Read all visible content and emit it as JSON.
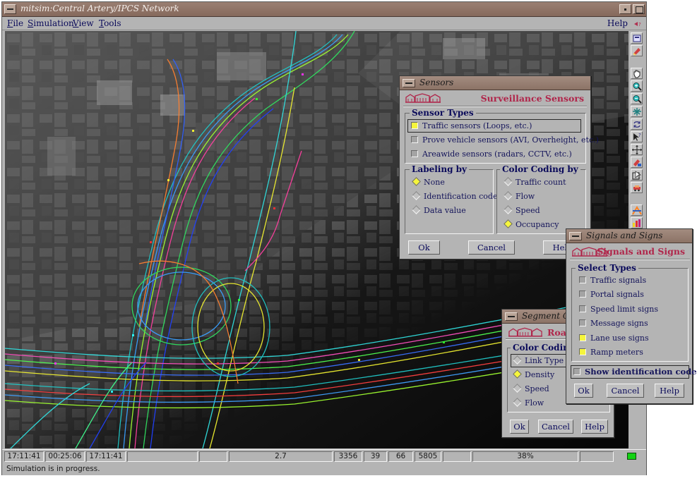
{
  "window": {
    "title": "mitsim:Central Artery/IPCS Network",
    "menu": [
      "File",
      "Simulation",
      "View",
      "Tools"
    ],
    "help": "Help",
    "help_icon": "help-pointer-icon"
  },
  "toolbar_icons": [
    "open-icon",
    "erase-icon",
    "pan-hand-icon",
    "zoom-in-icon",
    "zoom-out-icon",
    "grid-icon",
    "refresh-icon",
    "query-cursor-icon",
    "move-icon",
    "sensor-icon",
    "select-icon",
    "vehicle-icon",
    "signal-icon",
    "chart-icon"
  ],
  "status": {
    "time1": "17:11:41",
    "elapsed": "00:25:06",
    "time2": "17:11:41",
    "value1": "2.7",
    "count1": "3356",
    "count2": "39",
    "count3": "66",
    "count4": "5805",
    "percent": "38%",
    "message": "Simulation is in progress."
  },
  "sensors_dialog": {
    "title": "Sensors",
    "header": "Surveillance Sensors",
    "sensor_types_label": "Sensor Types",
    "sensor_types": [
      {
        "label": "Traffic sensors (Loops, etc.)",
        "checked": true
      },
      {
        "label": "Prove vehicle sensors (AVI, Overheight, etc.)",
        "checked": false
      },
      {
        "label": "Areawide sensors (radars, CCTV, etc.)",
        "checked": false
      }
    ],
    "labeling_label": "Labeling by",
    "labeling": [
      {
        "label": "None",
        "selected": true
      },
      {
        "label": "Identification code",
        "selected": false
      },
      {
        "label": "Data value",
        "selected": false
      }
    ],
    "coloring_label": "Color Coding by",
    "coloring": [
      {
        "label": "Traffic count",
        "selected": false
      },
      {
        "label": "Flow",
        "selected": false
      },
      {
        "label": "Speed",
        "selected": false
      },
      {
        "label": "Occupancy",
        "selected": true
      }
    ],
    "ok": "Ok",
    "cancel": "Cancel",
    "help": "Help"
  },
  "segment_dialog": {
    "title": "Segment Colors",
    "header": "Road Segments",
    "coloring_label": "Color Coding",
    "options": [
      {
        "label": "Link Type",
        "selected": false
      },
      {
        "label": "Density",
        "selected": true
      },
      {
        "label": "Speed",
        "selected": false
      },
      {
        "label": "Flow",
        "selected": false
      }
    ],
    "ok": "Ok",
    "cancel": "Cancel",
    "help": "Help"
  },
  "signals_dialog": {
    "title": "Signals and Signs",
    "header": "Signals and Signs",
    "select_label": "Select Types",
    "types": [
      {
        "label": "Traffic signals",
        "checked": false
      },
      {
        "label": "Portal signals",
        "checked": false
      },
      {
        "label": "Speed limit signs",
        "checked": false
      },
      {
        "label": "Message signs",
        "checked": false
      },
      {
        "label": "Lane use signs",
        "checked": true
      },
      {
        "label": "Ramp meters",
        "checked": true
      }
    ],
    "show_id": {
      "label": "Show identification code",
      "checked": false
    },
    "ok": "Ok",
    "cancel": "Cancel",
    "help": "Help"
  },
  "colors": {
    "title_bar": "#8c7366",
    "dialog_header": "#b0254a",
    "label_text": "#0a0a5a",
    "checked": "#f5f53c",
    "status_led": "#14d214"
  }
}
